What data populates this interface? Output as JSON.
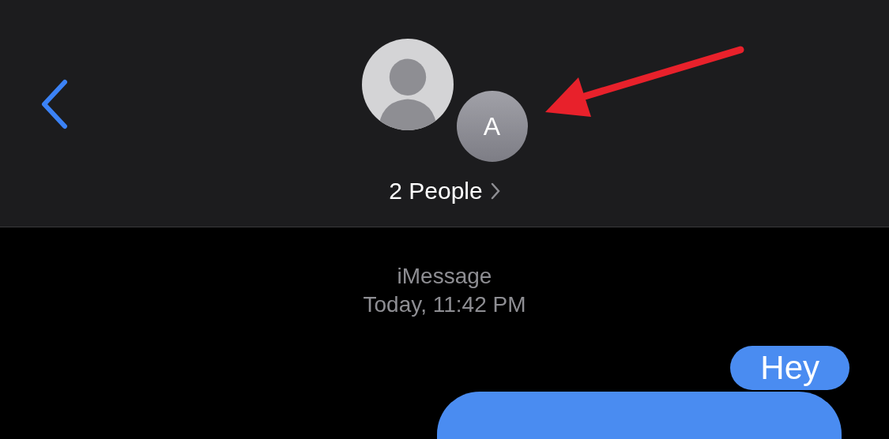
{
  "header": {
    "avatars": [
      {
        "kind": "silhouette"
      },
      {
        "kind": "initial",
        "initial": "A"
      }
    ],
    "title": "2 People"
  },
  "annotation": {
    "kind": "arrow"
  },
  "conversation": {
    "service": "iMessage",
    "timestamp": "Today, 11:42 PM",
    "messages": [
      {
        "kind": "text",
        "text": "Hey"
      },
      {
        "kind": "partial"
      }
    ]
  }
}
